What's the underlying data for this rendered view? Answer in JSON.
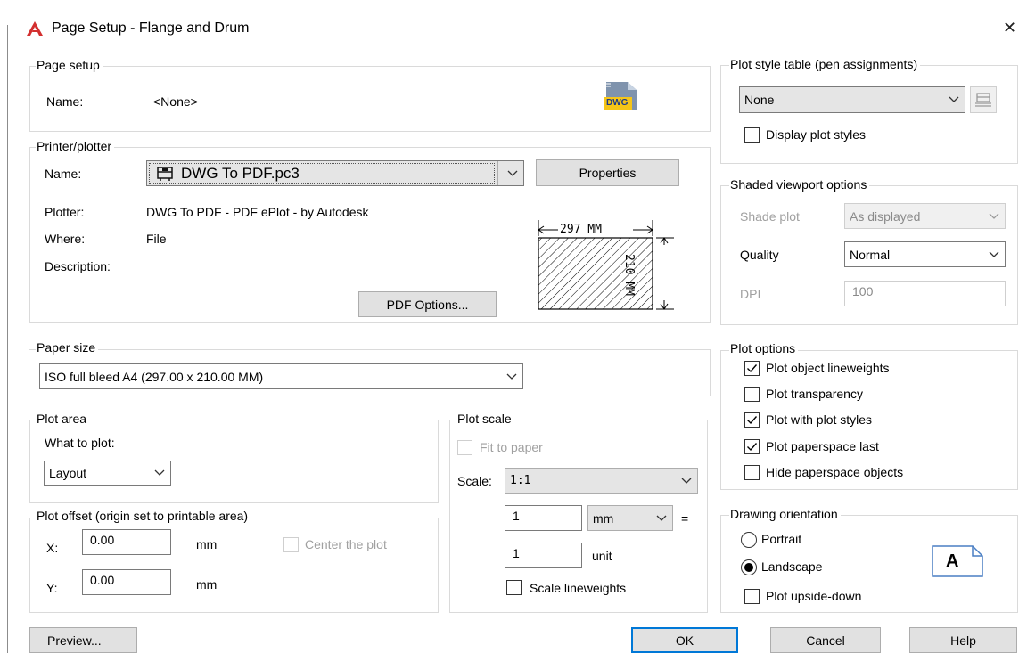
{
  "window": {
    "title": "Page Setup - Flange and Drum",
    "close_symbol": "✕",
    "accent": "#d32f2f"
  },
  "page_setup": {
    "title": "Page setup",
    "name_label": "Name:",
    "name_value": "<None>",
    "dwg_icon_text": "DWG"
  },
  "printer": {
    "title": "Printer/plotter",
    "name_label": "Name:",
    "device": "DWG To PDF.pc3",
    "properties_button": "Properties",
    "plotter_label": "Plotter:",
    "plotter_value": "DWG To PDF - PDF ePlot - by Autodesk",
    "where_label": "Where:",
    "where_value": "File",
    "description_label": "Description:",
    "pdf_options_button": "PDF Options...",
    "preview_width": "297  MM",
    "preview_height": "210  MM"
  },
  "paper_size": {
    "title": "Paper size",
    "value": "ISO full bleed A4 (297.00 x 210.00 MM)"
  },
  "plot_area": {
    "title": "Plot area",
    "what_label": "What to plot:",
    "value": "Layout"
  },
  "plot_offset": {
    "title": "Plot offset (origin set to printable area)",
    "x_label": "X:",
    "x_value": "0.00",
    "x_unit": "mm",
    "y_label": "Y:",
    "y_value": "0.00",
    "y_unit": "mm",
    "center_label": "Center the plot",
    "center_checked": false
  },
  "plot_scale": {
    "title": "Plot scale",
    "fit_label": "Fit to paper",
    "scale_label": "Scale:",
    "scale_value": "1:1",
    "numerator": "1",
    "unit_select": "mm",
    "equals": "=",
    "denominator": "1",
    "denominator_unit": "unit",
    "lineweights_label": "Scale lineweights",
    "lineweights_checked": false
  },
  "plot_style_table": {
    "title": "Plot style table (pen assignments)",
    "value": "None",
    "display_label": "Display plot styles",
    "display_checked": false
  },
  "shaded_viewport": {
    "title": "Shaded viewport options",
    "shade_label": "Shade plot",
    "shade_value": "As displayed",
    "quality_label": "Quality",
    "quality_value": "Normal",
    "dpi_label": "DPI",
    "dpi_value": "100"
  },
  "plot_options": {
    "title": "Plot options",
    "items": [
      {
        "label": "Plot object lineweights",
        "checked": true
      },
      {
        "label": "Plot transparency",
        "checked": false
      },
      {
        "label": "Plot with plot styles",
        "checked": true
      },
      {
        "label": "Plot paperspace last",
        "checked": true
      },
      {
        "label": "Hide paperspace objects",
        "checked": false
      }
    ]
  },
  "orientation": {
    "title": "Drawing orientation",
    "portrait_label": "Portrait",
    "landscape_label": "Landscape",
    "selected": "Landscape",
    "upside_down_label": "Plot upside-down",
    "upside_down_checked": false,
    "icon_letter": "A"
  },
  "footer": {
    "preview_button": "Preview...",
    "ok_button": "OK",
    "cancel_button": "Cancel",
    "help_button": "Help"
  }
}
